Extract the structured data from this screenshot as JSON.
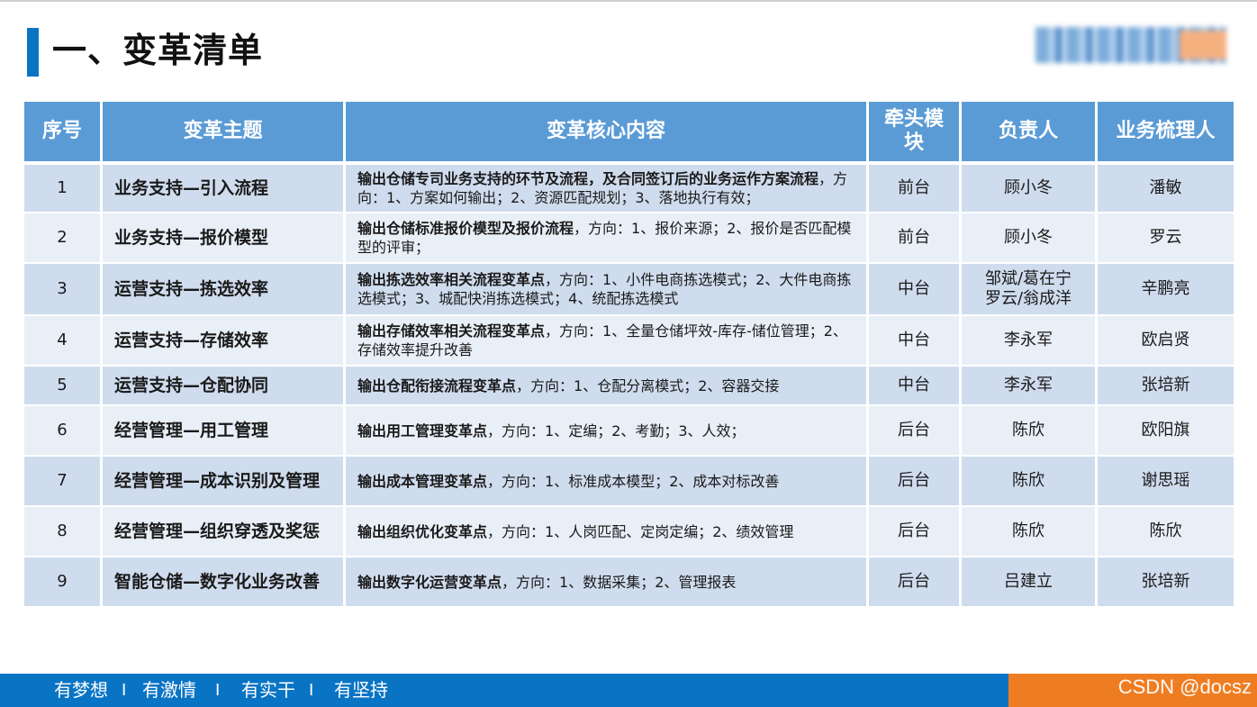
{
  "page": {
    "title": "一、变革清单"
  },
  "table": {
    "headers": [
      "序号",
      "变革主题",
      "变革核心内容",
      "牵头模块",
      "负责人",
      "业务梳理人"
    ],
    "rows": [
      {
        "no": "1",
        "theme": "业务支持—引入流程",
        "content_bold": "输出仓储专司业务支持的环节及流程，及合同签订后的业务运作方案流程",
        "content_rest": "，方向：1、方案如何输出；2、资源匹配规划；3、落地执行有效；",
        "module": "前台",
        "owner": "顾小冬",
        "analyst": "潘敏"
      },
      {
        "no": "2",
        "theme": "业务支持—报价模型",
        "content_bold": "输出仓储标准报价模型及报价流程",
        "content_rest": "，方向：1、报价来源；2、报价是否匹配模型的评审；",
        "module": "前台",
        "owner": "顾小冬",
        "analyst": "罗云"
      },
      {
        "no": "3",
        "theme": "运营支持—拣选效率",
        "content_bold": "输出拣选效率相关流程变革点",
        "content_rest": "，方向：1、小件电商拣选模式；2、大件电商拣选模式；3、城配快消拣选模式；4、统配拣选模式",
        "module": "中台",
        "owner": "邹斌/葛在宁\n罗云/翁成洋",
        "analyst": "辛鹏亮"
      },
      {
        "no": "4",
        "theme": "运营支持—存储效率",
        "content_bold": "输出存储效率相关流程变革点",
        "content_rest": "，方向：1、全量仓储坪效-库存-储位管理；2、存储效率提升改善",
        "module": "中台",
        "owner": "李永军",
        "analyst": "欧启贤"
      },
      {
        "no": "5",
        "theme": "运营支持—仓配协同",
        "content_bold": "输出仓配衔接流程变革点",
        "content_rest": "，方向：1、仓配分离模式；2、容器交接",
        "module": "中台",
        "owner": "李永军",
        "analyst": "张培新"
      },
      {
        "no": "6",
        "theme": "经营管理—用工管理",
        "content_bold": "输出用工管理变革点",
        "content_rest": "，方向：1、定编；2、考勤；3、人效；",
        "module": "后台",
        "owner": "陈欣",
        "analyst": "欧阳旗"
      },
      {
        "no": "7",
        "theme": "经营管理—成本识别及管理",
        "content_bold": "输出成本管理变革点",
        "content_rest": "，方向：1、标准成本模型；2、成本对标改善",
        "module": "后台",
        "owner": "陈欣",
        "analyst": "谢思瑶"
      },
      {
        "no": "8",
        "theme": "经营管理—组织穿透及奖惩",
        "content_bold": "输出组织优化变革点",
        "content_rest": "，方向：1、人岗匹配、定岗定编；2、绩效管理",
        "module": "后台",
        "owner": "陈欣",
        "analyst": "陈欣"
      },
      {
        "no": "9",
        "theme": "智能仓储—数字化业务改善",
        "content_bold": "输出数字化运营变革点",
        "content_rest": "，方向：1、数据采集；2、管理报表",
        "module": "后台",
        "owner": "吕建立",
        "analyst": "张培新"
      }
    ]
  },
  "footer": {
    "slogans": [
      "有梦想",
      "有激情",
      "有实干",
      "有坚持"
    ],
    "separator": "I",
    "watermark": "CSDN @docsz"
  },
  "colors": {
    "accent": "#0a74c4",
    "header_bg": "#5b9bd5",
    "row_odd": "#cfdcee",
    "row_even": "#e9eff7",
    "footer_orange": "#ee7d22"
  }
}
